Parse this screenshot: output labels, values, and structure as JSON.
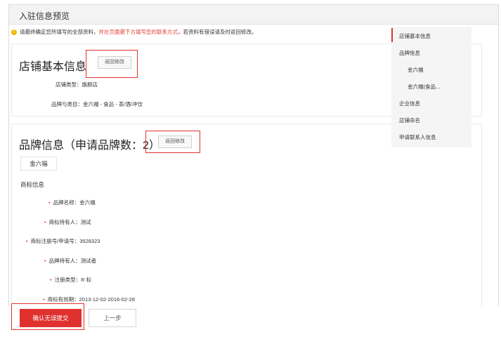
{
  "header": {
    "title": "入驻信息预览"
  },
  "notice": {
    "icon": "warning-icon",
    "part1": "请最终确定您所填写的全部资料，",
    "part2_red": "并在页面最下方填写您的联系方式",
    "part3": "，若资料有错误请及时返回修改。"
  },
  "store_section": {
    "title": "店铺基本信息",
    "return_label": "返回修改",
    "fields": [
      {
        "label": "店铺类型：",
        "value": "旗舰店"
      },
      {
        "label": "品牌与类目：",
        "value": "金六福 - 食品 - 茶/酒/冲饮"
      }
    ]
  },
  "brand_section": {
    "title": "品牌信息（申请品牌数：2）",
    "return_label": "返回修改",
    "tab": "金六福",
    "subhead": "商标信息",
    "fields": [
      {
        "label": "品牌名称：",
        "value": "金六福"
      },
      {
        "label": "商标持有人：",
        "value": "测试"
      },
      {
        "label": "商标注册号/申请号：",
        "value": "3528323"
      },
      {
        "label": "品牌持有人：",
        "value": "测试者"
      },
      {
        "label": "注册类型：",
        "value": "R 标"
      },
      {
        "label": "商标有效期：",
        "value": "2013-12-02-2016-02-28"
      }
    ]
  },
  "sidenav": {
    "items": [
      {
        "label": "店铺基本信息"
      },
      {
        "label": "品牌信息"
      },
      {
        "label": "金六福"
      },
      {
        "label": "金六福(食品..."
      },
      {
        "label": "企业信息"
      },
      {
        "label": "店铺命名"
      },
      {
        "label": "申请联系人信息"
      }
    ]
  },
  "footer": {
    "submit_label": "确认无误提交",
    "prev_label": "上一步"
  },
  "colors": {
    "accent": "#e0312f",
    "highlight_box": "#e03131",
    "warning": "#f5b400"
  }
}
